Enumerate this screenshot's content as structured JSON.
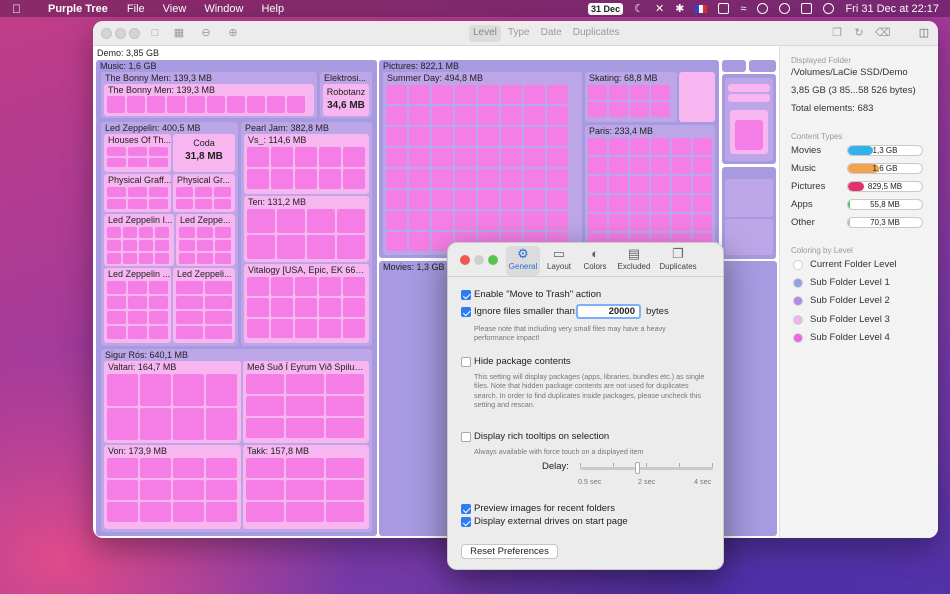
{
  "menubar": {
    "app": "Purple Tree",
    "menus": [
      "File",
      "View",
      "Window",
      "Help"
    ],
    "date_badge": "31 Dec",
    "clock": "Fri 31 Dec at 22:17"
  },
  "toolbar": {
    "modes": [
      "Level",
      "Type",
      "Date",
      "Duplicates"
    ],
    "active_mode": "Level"
  },
  "treemap": {
    "root": "Demo: 3,85 GB",
    "music": "Music: 1,6 GB",
    "bonny_outer": "The Bonny Men: 139,3 MB",
    "bonny_inner": "The Bonny Men: 139,3 MB",
    "elektrosi": "Elektrosi...",
    "robotanz_name": "Robotanz",
    "robotanz_size": "34,6 MB",
    "zeppelin": "Led Zeppelin: 400,5 MB",
    "houses": "Houses Of Th...",
    "coda_name": "Coda",
    "coda_size": "31,8 MB",
    "pgraff": "Physical Graff...",
    "pgr": "Physical Gr...",
    "lz1": "Led Zeppelin I...",
    "lz2": "Led Zeppe...",
    "lz3": "Led Zeppelin ...",
    "lz4": "Led Zeppeli...",
    "pearl": "Pearl Jam: 382,8 MB",
    "vs": "Vs_: 114,6 MB",
    "ten": "Ten: 131,2 MB",
    "vitalogy": "Vitalogy [USA, Epic, EK 669...",
    "sigur": "Sigur Rós: 640,1 MB",
    "valtari": "Valtari: 164,7 MB",
    "medsud": "Með Suð Í Eyrum Við Spilum...",
    "von": "Von: 173,9 MB",
    "takk": "Takk: 157,8 MB",
    "pictures": "Pictures: 822,1 MB",
    "summer": "Summer Day: 494,8 MB",
    "skating": "Skating: 68,8 MB",
    "paris": "Paris: 233,4 MB",
    "movies": "Movies: 1,3 GB"
  },
  "sidebar": {
    "displayed_folder_h": "Displayed Folder",
    "folder_path": "/Volumes/LaCie SSD/Demo",
    "total_size": "3,85 GB (3 85...58 526 bytes)",
    "total_elements": "Total elements: 683",
    "content_types_h": "Content Types",
    "types": [
      {
        "name": "Movies",
        "value": "1,3 GB",
        "fill": 0.34,
        "color": "#2fb3e8"
      },
      {
        "name": "Music",
        "value": "1,6 GB",
        "fill": 0.42,
        "color": "#f0a24f"
      },
      {
        "name": "Pictures",
        "value": "829,5 MB",
        "fill": 0.21,
        "color": "#e0326e"
      },
      {
        "name": "Apps",
        "value": "55,8 MB",
        "fill": 0.02,
        "color": "#46c46a"
      },
      {
        "name": "Other",
        "value": "70,3 MB",
        "fill": 0.02,
        "color": "#bbbbbb"
      }
    ],
    "coloring_h": "Coloring by Level",
    "levels": [
      {
        "name": "Current Folder Level",
        "color": "#ffffff"
      },
      {
        "name": "Sub Folder Level 1",
        "color": "#8fa3e6"
      },
      {
        "name": "Sub Folder Level 2",
        "color": "#b08ee0"
      },
      {
        "name": "Sub Folder Level 3",
        "color": "#f5b3ee"
      },
      {
        "name": "Sub Folder Level 4",
        "color": "#f266dd"
      }
    ]
  },
  "prefs": {
    "tabs": [
      "General",
      "Layout",
      "Colors",
      "Excluded",
      "Duplicates"
    ],
    "active_tab": "General",
    "trash": "Enable \"Move to Trash\" action",
    "ignore_small": "Ignore files smaller than:",
    "ignore_value": "20000",
    "bytes": "bytes",
    "ignore_note": "Please note that including very small files may have a heavy performance impact!",
    "hide_pkg": "Hide package contents",
    "hide_pkg_note": "This setting will display packages (apps, libraries, bundles etc.) as single files. Note that hidden package contents are not used for duplicates search. In order to find duplicates inside packages, please uncheck this setting and rescan.",
    "tooltips": "Display rich tooltips on selection",
    "tooltips_note": "Always available with force touch on a displayed item",
    "delay": "Delay:",
    "delay_min": "0.5 sec",
    "delay_mid": "2 sec",
    "delay_max": "4 sec",
    "delay_value": 2,
    "preview": "Preview images for recent folders",
    "external": "Display external drives on start page",
    "reset": "Reset Preferences"
  }
}
